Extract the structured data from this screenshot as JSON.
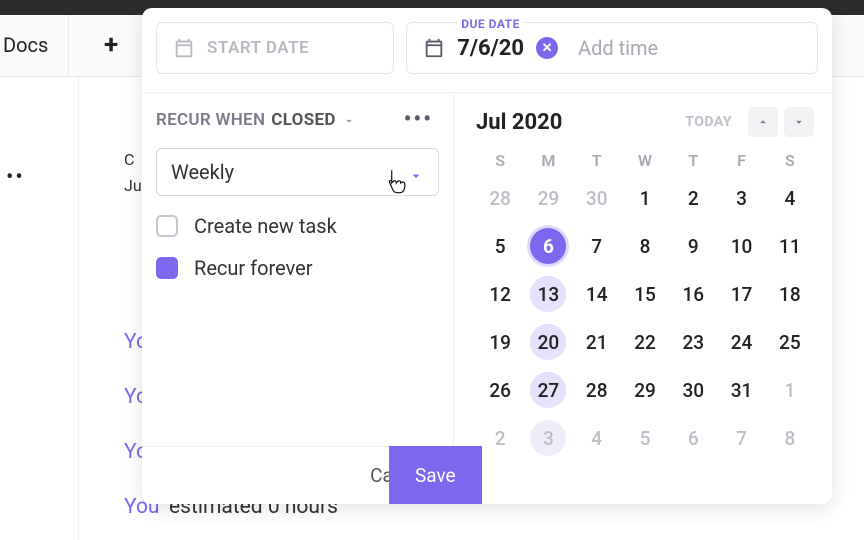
{
  "background": {
    "docs_label": "Docs",
    "activity": [
      {
        "text_a": "Yo"
      },
      {
        "text_a": "Yo"
      },
      {
        "text_a": "Yo"
      },
      {
        "text_a": "You",
        "text_b": "estimated 0 hours"
      }
    ],
    "left_crumb": "C",
    "left_crumb2": "Ju"
  },
  "modal": {
    "start_placeholder": "START DATE",
    "due_heading": "DUE DATE",
    "due_value": "7/6/20",
    "add_time_label": "Add time",
    "recur": {
      "prefix": "RECUR WHEN",
      "state": "CLOSED",
      "frequency": "Weekly",
      "option_create": "Create new task",
      "option_forever": "Recur forever",
      "create_checked": false,
      "forever_checked": true
    },
    "calendar": {
      "month_label": "Jul 2020",
      "today_label": "TODAY",
      "weekdays": [
        "S",
        "M",
        "T",
        "W",
        "T",
        "F",
        "S"
      ],
      "days": [
        {
          "n": 28,
          "muted": true
        },
        {
          "n": 29,
          "muted": true
        },
        {
          "n": 30,
          "muted": true,
          "box": true
        },
        {
          "n": 1
        },
        {
          "n": 2
        },
        {
          "n": 3
        },
        {
          "n": 4
        },
        {
          "n": 5
        },
        {
          "n": 6,
          "selected": true
        },
        {
          "n": 7
        },
        {
          "n": 8
        },
        {
          "n": 9
        },
        {
          "n": 10
        },
        {
          "n": 11
        },
        {
          "n": 12
        },
        {
          "n": 13,
          "highlight": true
        },
        {
          "n": 14
        },
        {
          "n": 15
        },
        {
          "n": 16
        },
        {
          "n": 17
        },
        {
          "n": 18
        },
        {
          "n": 19
        },
        {
          "n": 20,
          "highlight": true
        },
        {
          "n": 21
        },
        {
          "n": 22
        },
        {
          "n": 23
        },
        {
          "n": 24
        },
        {
          "n": 25
        },
        {
          "n": 26
        },
        {
          "n": 27,
          "highlight": true
        },
        {
          "n": 28
        },
        {
          "n": 29
        },
        {
          "n": 30
        },
        {
          "n": 31
        },
        {
          "n": 1,
          "muted": true,
          "box2": true
        },
        {
          "n": 2,
          "muted": true
        },
        {
          "n": 3,
          "muted": true,
          "hlmuted": true
        },
        {
          "n": 4,
          "muted": true
        },
        {
          "n": 5,
          "muted": true
        },
        {
          "n": 6,
          "muted": true
        },
        {
          "n": 7,
          "muted": true
        },
        {
          "n": 8,
          "muted": true
        }
      ]
    },
    "footer": {
      "cancel": "Cancel",
      "save": "Save"
    }
  }
}
